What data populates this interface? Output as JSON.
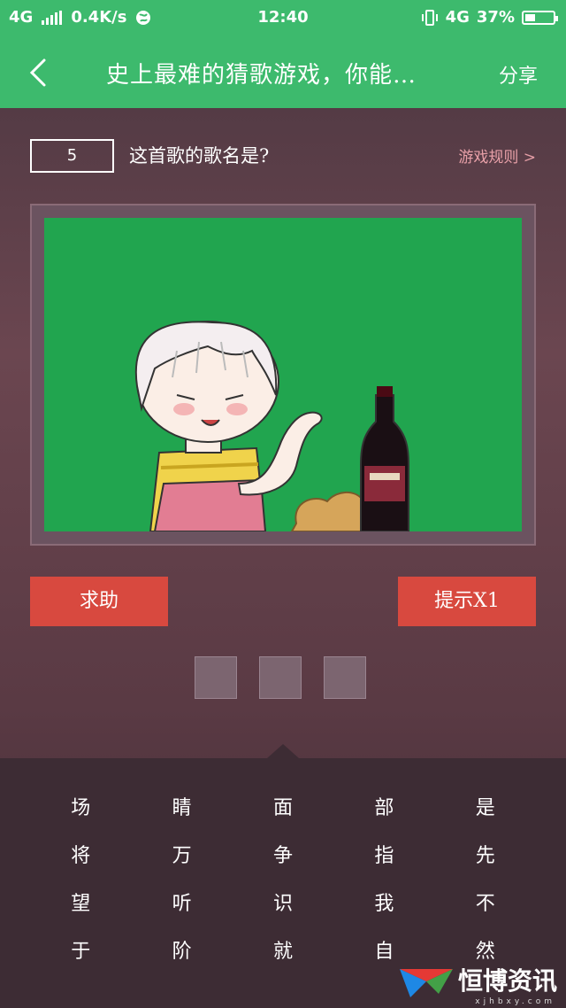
{
  "status_bar": {
    "network_left": "4G",
    "speed": "0.4K/s",
    "time": "12:40",
    "network_right": "4G",
    "battery_percent": "37%",
    "battery_level": 0.37
  },
  "nav": {
    "title": "史上最难的猜歌游戏，你能…",
    "share_label": "分享"
  },
  "question": {
    "level": "5",
    "prompt": "这首歌的歌名是?",
    "rules_link": "游戏规则 >"
  },
  "buttons": {
    "help_label": "求助",
    "hint_label": "提示X1"
  },
  "answer_slots": [
    "",
    "",
    ""
  ],
  "keyboard": {
    "keys": [
      "场",
      "睛",
      "面",
      "部",
      "是",
      "将",
      "万",
      "争",
      "指",
      "先",
      "望",
      "听",
      "识",
      "我",
      "不",
      "于",
      "阶",
      "就",
      "自",
      "然"
    ]
  },
  "watermark": {
    "brand": "恒博资讯",
    "url": "xjhbxy.com"
  },
  "colors": {
    "header_green": "#3dba6d",
    "button_red": "#d8493f",
    "picture_green": "#21a54f"
  }
}
